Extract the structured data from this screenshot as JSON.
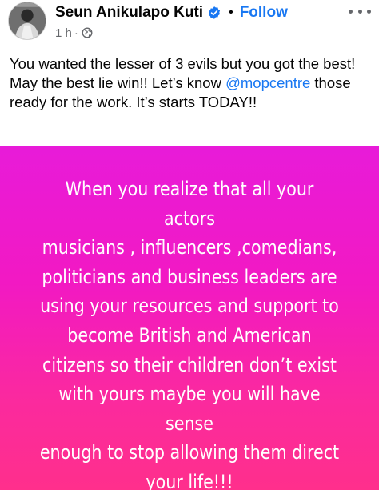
{
  "post": {
    "author": {
      "name": "Seun Anikulapo Kuti",
      "verified_icon": "verified-badge-icon",
      "avatar_icon": "profile-avatar"
    },
    "separator": "•",
    "follow_label": "Follow",
    "time": "1 h",
    "meta_separator": "·",
    "audience_icon": "globe-icon",
    "more_icon": "more-options-icon",
    "caption": {
      "before_mention": "You wanted the lesser of 3 evils but you got the best! May the best lie win!! Let’s know ",
      "mention": "@mopcentre",
      "after_mention": " those ready for the work. It’s starts TODAY!!"
    },
    "image_text": "When you realize that all your actors\nmusicians , influencers ,comedians,\npoliticians and business leaders are\nusing your resources and support to\nbecome British and American\ncitizens so their children don’t exist\nwith yours maybe you will have sense\nenough to stop allowing them direct\nyour life!!!",
    "colors": {
      "link": "#1877f2",
      "muted": "#65676b",
      "gradient_top": "#e81bd9",
      "gradient_bottom": "#ff2f8c"
    }
  }
}
